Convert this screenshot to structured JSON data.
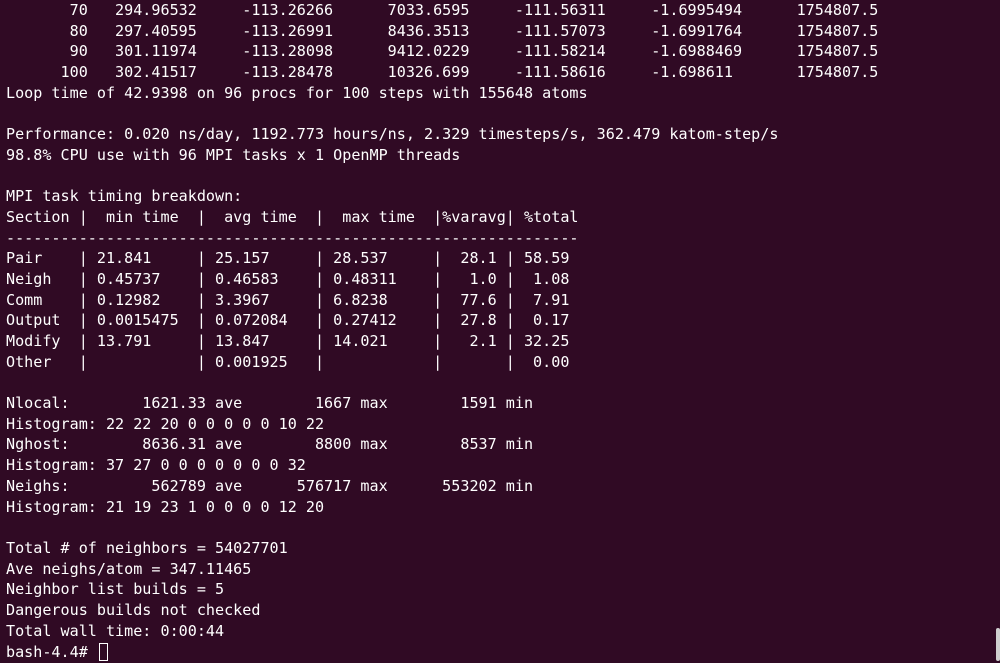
{
  "terminal": {
    "background": "#300a24",
    "foreground": "#ffffff",
    "lines": [
      "       70   294.96532     -113.26266      7033.6595     -111.56311     -1.6995494      1754807.5",
      "       80   297.40595     -113.26991      8436.3513     -111.57073     -1.6991764      1754807.5",
      "       90   301.11974     -113.28098      9412.0229     -111.58214     -1.6988469      1754807.5",
      "      100   302.41517     -113.28478      10326.699     -111.58616     -1.698611       1754807.5",
      "Loop time of 42.9398 on 96 procs for 100 steps with 155648 atoms",
      "",
      "Performance: 0.020 ns/day, 1192.773 hours/ns, 2.329 timesteps/s, 362.479 katom-step/s",
      "98.8% CPU use with 96 MPI tasks x 1 OpenMP threads",
      "",
      "MPI task timing breakdown:",
      "Section |  min time  |  avg time  |  max time  |%varavg| %total",
      "---------------------------------------------------------------",
      "Pair    | 21.841     | 25.157     | 28.537     |  28.1 | 58.59",
      "Neigh   | 0.45737    | 0.46583    | 0.48311    |   1.0 |  1.08",
      "Comm    | 0.12982    | 3.3967     | 6.8238     |  77.6 |  7.91",
      "Output  | 0.0015475  | 0.072084   | 0.27412    |  27.8 |  0.17",
      "Modify  | 13.791     | 13.847     | 14.021     |   2.1 | 32.25",
      "Other   |            | 0.001925   |            |       |  0.00",
      "",
      "Nlocal:        1621.33 ave        1667 max        1591 min",
      "Histogram: 22 22 20 0 0 0 0 0 10 22",
      "Nghost:        8636.31 ave        8800 max        8537 min",
      "Histogram: 37 27 0 0 0 0 0 0 0 32",
      "Neighs:         562789 ave      576717 max      553202 min",
      "Histogram: 21 19 23 1 0 0 0 0 12 20",
      "",
      "Total # of neighbors = 54027701",
      "Ave neighs/atom = 347.11465",
      "Neighbor list builds = 5",
      "Dangerous builds not checked",
      "Total wall time: 0:00:44"
    ],
    "prompt": "bash-4.4# "
  }
}
